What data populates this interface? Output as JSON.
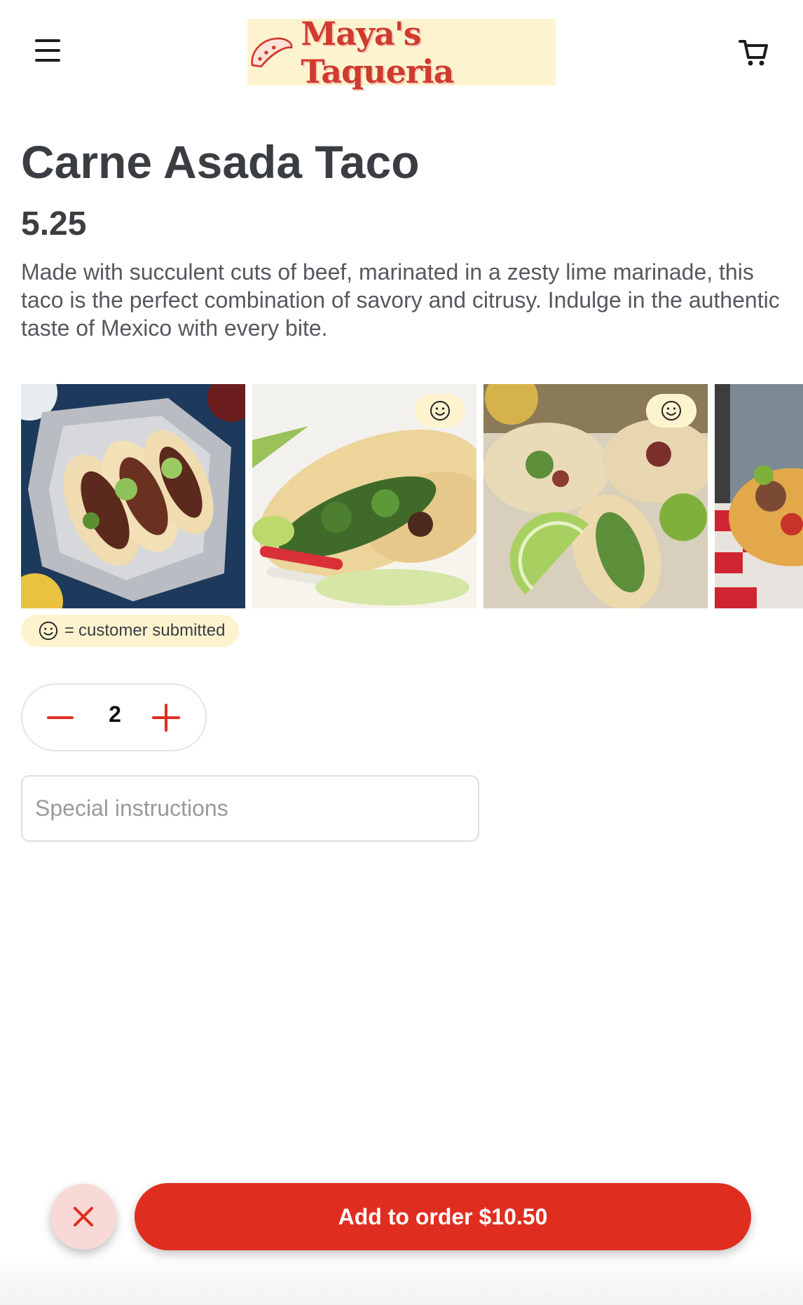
{
  "header": {
    "menu_icon": "hamburger-menu-icon",
    "logo_text": "Maya's Taqueria",
    "logo_icon": "taco-icon",
    "cart_icon": "cart-icon"
  },
  "item": {
    "title": "Carne Asada Taco",
    "price": "5.25",
    "description": "Made with succulent cuts of beef, marinated in a zesty lime marinade, this taco is the perfect combination of savory and citrusy. Indulge in the authentic taste of Mexico with every bite."
  },
  "gallery": {
    "photos": [
      {
        "subject": "tacos on foil",
        "customer_submitted": false
      },
      {
        "subject": "tacos with radish",
        "customer_submitted": true
      },
      {
        "subject": "street tacos with lime",
        "customer_submitted": true
      },
      {
        "subject": "taco on red tablecloth",
        "customer_submitted": false
      }
    ],
    "badge_icon": "smiley-icon",
    "legend_separator": "=",
    "legend_label": "customer submitted"
  },
  "order": {
    "quantity": "2",
    "minus_icon": "minus-icon",
    "plus_icon": "plus-icon",
    "instructions_placeholder": "Special instructions",
    "close_icon": "close-icon",
    "add_button_label": "Add to order $10.50"
  },
  "colors": {
    "accent_red": "#df2e20",
    "cream": "#fdf4cf",
    "text_dark": "#3a3d42"
  }
}
